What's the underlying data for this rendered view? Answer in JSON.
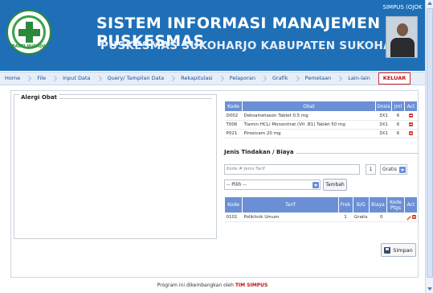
{
  "header": {
    "title": "SISTEM INFORMASI MANAJEMEN PUSKESMAS",
    "subtitle": "PUSKESMAS SUKOHARJO KABUPATEN SUKOHARJO",
    "logo_text": "BAKTI HUSADA",
    "user_name": "SIMPUS (OJOK"
  },
  "menu": {
    "items": [
      "Home",
      "File",
      "Input Data",
      "Query/ Tampilan Data",
      "Rekapitulasi",
      "Pelaporan",
      "Grafik",
      "Pemetaan",
      "Lain-lain"
    ],
    "exit_label": "KELUAR"
  },
  "allergy": {
    "legend": "Alergi Obat"
  },
  "meds": {
    "columns": [
      "Kode",
      "Obat",
      "Dosis",
      "Jml",
      "Act"
    ],
    "rows": [
      {
        "kode": "D002",
        "obat": "Deksametason Tablet 0,5 mg",
        "dosis": "3X1",
        "jml": "6"
      },
      {
        "kode": "T006",
        "obat": "Tiamin HCL/ Mononitrat (Vit .B1) Tablet 50 mg",
        "dosis": "3X1",
        "jml": "6"
      },
      {
        "kode": "P021",
        "obat": "Piroxicam 20 mg",
        "dosis": "3X1",
        "jml": "6"
      }
    ]
  },
  "tindakan": {
    "legend": "Jenis Tindakan / Biaya",
    "kode_placeholder": "Kode # Jenis Tarif",
    "qty_value": "1",
    "gratis_value": "Gratis",
    "pilih_value": "-- Pilih --",
    "tambah_label": "Tambah",
    "columns": [
      "Kode",
      "Tarif",
      "Frek",
      "B/G",
      "Biaya",
      "Kode Ptgs",
      "Act"
    ],
    "rows": [
      {
        "kode": "0101",
        "tarif": "Poliklinik Umum",
        "frek": "1",
        "bg": "Gratis",
        "biaya": "0",
        "ptgs": ""
      }
    ]
  },
  "actions": {
    "simpan_label": "Simpan"
  },
  "footer": {
    "text": "Program ini dikembangkan oleh ",
    "highlight": "TIM SIMPUS"
  },
  "colors": {
    "header_bg": "#1f6fb6",
    "table_header": "#6b8fd4",
    "exit": "#c0101a"
  }
}
